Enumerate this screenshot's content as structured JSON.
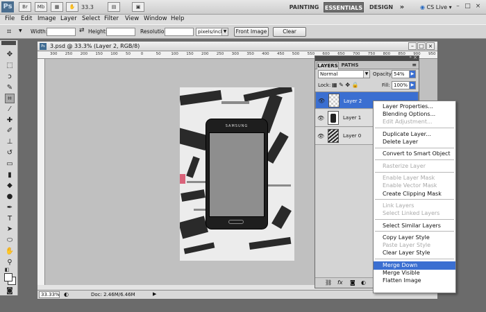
{
  "app": {
    "logo": "Ps",
    "buttons": [
      "Br",
      "Mb"
    ],
    "zoom": "33.3",
    "workspaces": [
      "PAINTING",
      "ESSENTIALS",
      "DESIGN"
    ],
    "more": "»",
    "cslive": "CS Live ▾",
    "window_controls": [
      "–",
      "□",
      "×"
    ]
  },
  "menu": [
    "File",
    "Edit",
    "Image",
    "Layer",
    "Select",
    "Filter",
    "View",
    "Window",
    "Help"
  ],
  "options": {
    "width_label": "Width:",
    "height_label": "Height:",
    "resolution_label": "Resolution:",
    "unit": "pixels/inch",
    "front_image": "Front Image",
    "clear": "Clear"
  },
  "document": {
    "title": "3.psd @ 33.3% (Layer 2, RGB/8)",
    "status_zoom": "33.33%",
    "status_doc": "Doc: 2.46M/6.46M",
    "ruler_ticks": [
      "300",
      "250",
      "200",
      "150",
      "100",
      "50",
      "0",
      "50",
      "100",
      "150",
      "200",
      "250",
      "300",
      "350",
      "400",
      "450",
      "500",
      "550",
      "600",
      "650",
      "700",
      "750",
      "800",
      "850",
      "900",
      "950"
    ],
    "phone_brand": "SAMSUNG"
  },
  "layers_panel": {
    "tabs": [
      "LAYERS",
      "PATHS"
    ],
    "blend_mode": "Normal",
    "opacity_label": "Opacity:",
    "opacity": "54%",
    "lock_label": "Lock:",
    "fill_label": "Fill:",
    "fill": "100%",
    "layers": [
      {
        "name": "Layer 2",
        "selected": true
      },
      {
        "name": "Layer 1",
        "selected": false
      },
      {
        "name": "Layer 0",
        "selected": false
      }
    ]
  },
  "context_menu": {
    "groups": [
      [
        {
          "label": "Layer Properties...",
          "disabled": false
        },
        {
          "label": "Blending Options...",
          "disabled": false
        },
        {
          "label": "Edit Adjustment...",
          "disabled": true
        }
      ],
      [
        {
          "label": "Duplicate Layer...",
          "disabled": false
        },
        {
          "label": "Delete Layer",
          "disabled": false
        }
      ],
      [
        {
          "label": "Convert to Smart Object",
          "disabled": false
        }
      ],
      [
        {
          "label": "Rasterize Layer",
          "disabled": true
        }
      ],
      [
        {
          "label": "Enable Layer Mask",
          "disabled": true
        },
        {
          "label": "Enable Vector Mask",
          "disabled": true
        },
        {
          "label": "Create Clipping Mask",
          "disabled": false
        }
      ],
      [
        {
          "label": "Link Layers",
          "disabled": true
        },
        {
          "label": "Select Linked Layers",
          "disabled": true
        }
      ],
      [
        {
          "label": "Select Similar Layers",
          "disabled": false
        }
      ],
      [
        {
          "label": "Copy Layer Style",
          "disabled": false
        },
        {
          "label": "Paste Layer Style",
          "disabled": true
        },
        {
          "label": "Clear Layer Style",
          "disabled": false
        }
      ],
      [
        {
          "label": "Merge Down",
          "disabled": false,
          "highlighted": true
        },
        {
          "label": "Merge Visible",
          "disabled": false
        },
        {
          "label": "Flatten Image",
          "disabled": false
        }
      ]
    ]
  },
  "colors": {
    "accent": "#3b6fd1",
    "workspace_active": "#6e6e6e"
  }
}
